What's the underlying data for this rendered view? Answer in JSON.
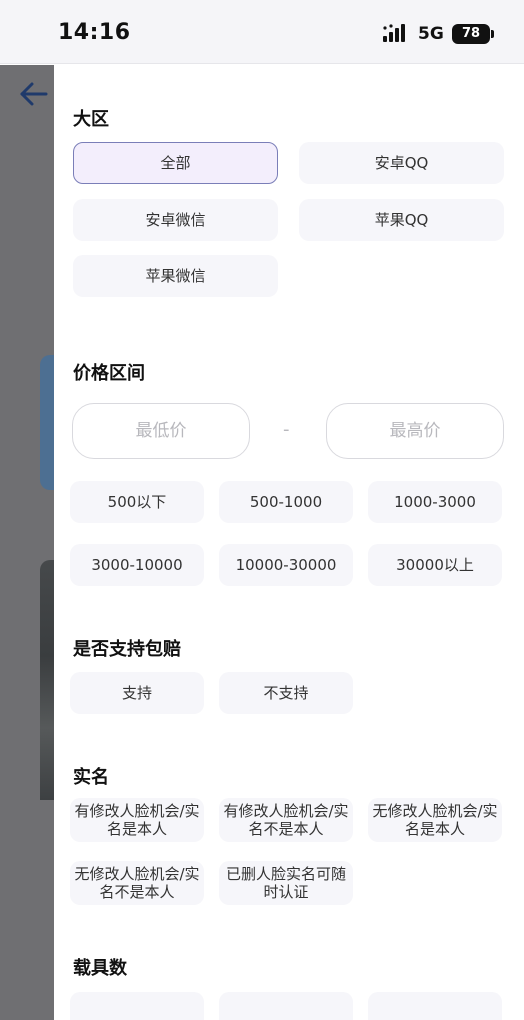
{
  "status_bar": {
    "time": "14:16",
    "network": "5G",
    "battery": "78"
  },
  "filters": {
    "region": {
      "title": "大区",
      "options": [
        "全部",
        "安卓QQ",
        "安卓微信",
        "苹果QQ",
        "苹果微信"
      ],
      "selected": "全部"
    },
    "price": {
      "title": "价格区间",
      "min_placeholder": "最低价",
      "max_placeholder": "最高价",
      "separator": "-",
      "ranges": [
        "500以下",
        "500-1000",
        "1000-3000",
        "3000-10000",
        "10000-30000",
        "30000以上"
      ]
    },
    "guarantee": {
      "title": "是否支持包赔",
      "options": [
        "支持",
        "不支持"
      ]
    },
    "realname": {
      "title": "实名",
      "options": [
        "有修改人脸机会/实名是本人",
        "有修改人脸机会/实名不是本人",
        "无修改人脸机会/实名是本人",
        "无修改人脸机会/实名不是本人",
        "已删人脸实名可随时认证"
      ]
    },
    "vehicles": {
      "title": "载具数"
    }
  }
}
